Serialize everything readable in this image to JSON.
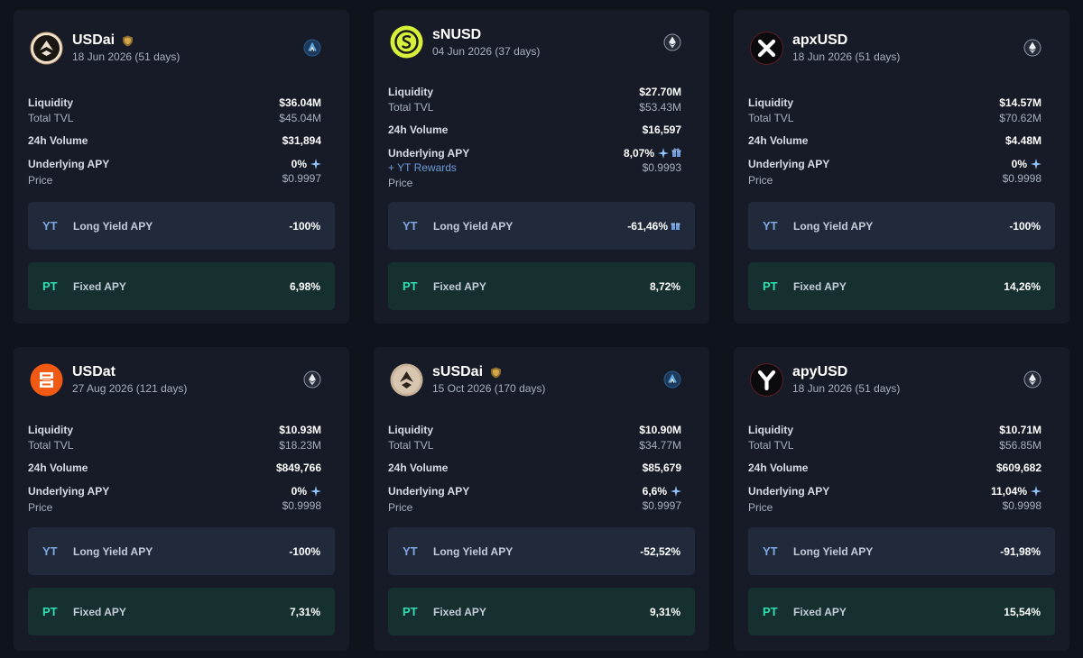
{
  "labels": {
    "liquidity": "Liquidity",
    "total_tvl": "Total TVL",
    "volume_24h": "24h Volume",
    "underlying_apy": "Underlying APY",
    "price": "Price",
    "yt_rewards": "+ YT Rewards",
    "yt_tag": "YT",
    "pt_tag": "PT",
    "long_yield_apy": "Long Yield APY",
    "fixed_apy": "Fixed APY"
  },
  "colors": {
    "background": "#0f131c",
    "card": "#161b27",
    "yt_pill": "#202a3b",
    "pt_pill": "#15302f",
    "yt_accent": "#7fa6e3",
    "pt_accent": "#2ee0b0"
  },
  "cards": [
    {
      "name": "USDai",
      "date": "18 Jun 2026 (51 days)",
      "verified": true,
      "logo_icon": "usdai-logo-icon",
      "chain_icon": "arbitrum-icon",
      "liquidity": "$36.04M",
      "total_tvl": "$45.04M",
      "volume_24h": "$31,894",
      "underlying_apy": "0%",
      "price": "$0.9997",
      "yt_rewards": false,
      "long_yield_apy": "-100%",
      "fixed_apy": "6,98%"
    },
    {
      "name": "sNUSD",
      "date": "04 Jun 2026 (37 days)",
      "verified": false,
      "logo_icon": "snusd-logo-icon",
      "chain_icon": "ethereum-icon",
      "liquidity": "$27.70M",
      "total_tvl": "$53.43M",
      "volume_24h": "$16,597",
      "underlying_apy": "8,07%",
      "price": "$0.9993",
      "yt_rewards": true,
      "long_yield_apy": "-61,46%",
      "fixed_apy": "8,72%"
    },
    {
      "name": "apxUSD",
      "date": "18 Jun 2026 (51 days)",
      "verified": false,
      "logo_icon": "apxusd-logo-icon",
      "chain_icon": "ethereum-icon",
      "liquidity": "$14.57M",
      "total_tvl": "$70.62M",
      "volume_24h": "$4.48M",
      "underlying_apy": "0%",
      "price": "$0.9998",
      "yt_rewards": false,
      "long_yield_apy": "-100%",
      "fixed_apy": "14,26%"
    },
    {
      "name": "USDat",
      "date": "27 Aug 2026 (121 days)",
      "verified": false,
      "logo_icon": "usdat-logo-icon",
      "chain_icon": "ethereum-icon",
      "liquidity": "$10.93M",
      "total_tvl": "$18.23M",
      "volume_24h": "$849,766",
      "underlying_apy": "0%",
      "price": "$0.9998",
      "yt_rewards": false,
      "long_yield_apy": "-100%",
      "fixed_apy": "7,31%"
    },
    {
      "name": "sUSDai",
      "date": "15 Oct 2026 (170 days)",
      "verified": true,
      "logo_icon": "susdai-logo-icon",
      "chain_icon": "arbitrum-icon",
      "liquidity": "$10.90M",
      "total_tvl": "$34.77M",
      "volume_24h": "$85,679",
      "underlying_apy": "6,6%",
      "price": "$0.9997",
      "yt_rewards": false,
      "long_yield_apy": "-52,52%",
      "fixed_apy": "9,31%"
    },
    {
      "name": "apyUSD",
      "date": "18 Jun 2026 (51 days)",
      "verified": false,
      "logo_icon": "apyusd-logo-icon",
      "chain_icon": "ethereum-icon",
      "liquidity": "$10.71M",
      "total_tvl": "$56.85M",
      "volume_24h": "$609,682",
      "underlying_apy": "11,04%",
      "price": "$0.9998",
      "yt_rewards": false,
      "long_yield_apy": "-91,98%",
      "fixed_apy": "15,54%"
    }
  ]
}
